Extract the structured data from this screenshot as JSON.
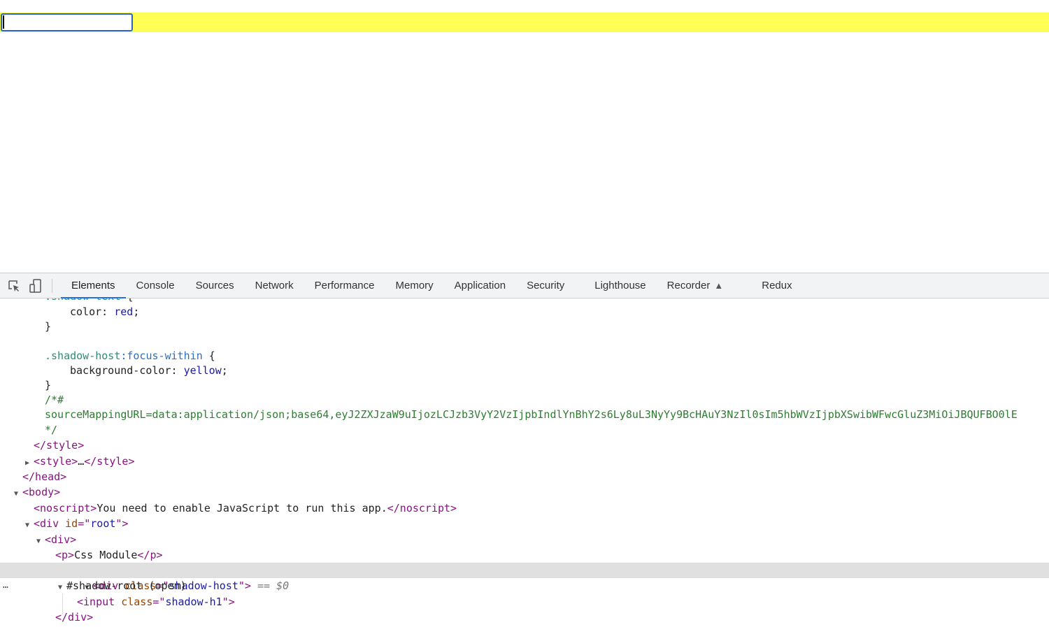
{
  "page": {
    "input_value": "",
    "host_background": "#ffff55",
    "focus_ring_color": "#2a63cc"
  },
  "devtools": {
    "toolbar": {
      "inspect_icon": "inspect-element-icon",
      "device_icon": "device-toolbar-icon",
      "tabs": [
        {
          "label": "Elements",
          "active": true
        },
        {
          "label": "Console"
        },
        {
          "label": "Sources"
        },
        {
          "label": "Network"
        },
        {
          "label": "Performance"
        },
        {
          "label": "Memory"
        },
        {
          "label": "Application"
        },
        {
          "label": "Security"
        },
        {
          "label": "Lighthouse"
        },
        {
          "label": "Recorder",
          "icon": "flask-icon"
        },
        {
          "label": "Redux"
        }
      ],
      "active_color": "#1a73e8"
    },
    "code": {
      "l1_sel": ".shadow-text",
      "l1_brace": " {",
      "l2_prop": "color: ",
      "l2_val": "red",
      "l2_end": ";",
      "l3": "}",
      "l5_sel": ".shadow-host",
      "l5_pseudo": ":focus-within",
      "l5_brace": " {",
      "l6_prop": "background-color: ",
      "l6_val": "yellow",
      "l6_end": ";",
      "l7": "}",
      "l8": "/*#",
      "l9": "sourceMappingURL=data:application/json;base64,eyJ2ZXJzaW9uIjozLCJzb3VyY2VzIjpbIndlYnBhY2s6Ly8uL3NyYy9BcHAuY3NzIl0sIm5hbWVzIjpbXSwibWFwcGluZ3MiOiJBQUFBO0lE",
      "l10": "*/",
      "l11": "</style>",
      "l12_open": "<style>",
      "l12_ell": "…",
      "l12_close": "</style>",
      "l13": "</head>",
      "l14": "<body>",
      "l15_open": "<noscript>",
      "l15_text": "You need to enable JavaScript to run this app.",
      "l15_close": "</noscript>",
      "l16_tag": "<div ",
      "l16_attr": "id",
      "l16_eq": "=\"",
      "l16_val": "root",
      "l16_end": "\">",
      "l17": "<div>",
      "l18_open": "<p>",
      "l18_text": "Css Module",
      "l18_close": "</p>",
      "l19_tag": "<div ",
      "l19_attr": "class",
      "l19_eq": "=\"",
      "l19_val": "shadow-host",
      "l19_end": "\">",
      "l19_ref": " == $0",
      "l19_dots": "…",
      "l20": "#shadow-root (open)",
      "l21_tag": "<input ",
      "l21_attr": "class",
      "l21_eq": "=\"",
      "l21_val": "shadow-h1",
      "l21_end": "\">",
      "l22": "</div>"
    }
  }
}
